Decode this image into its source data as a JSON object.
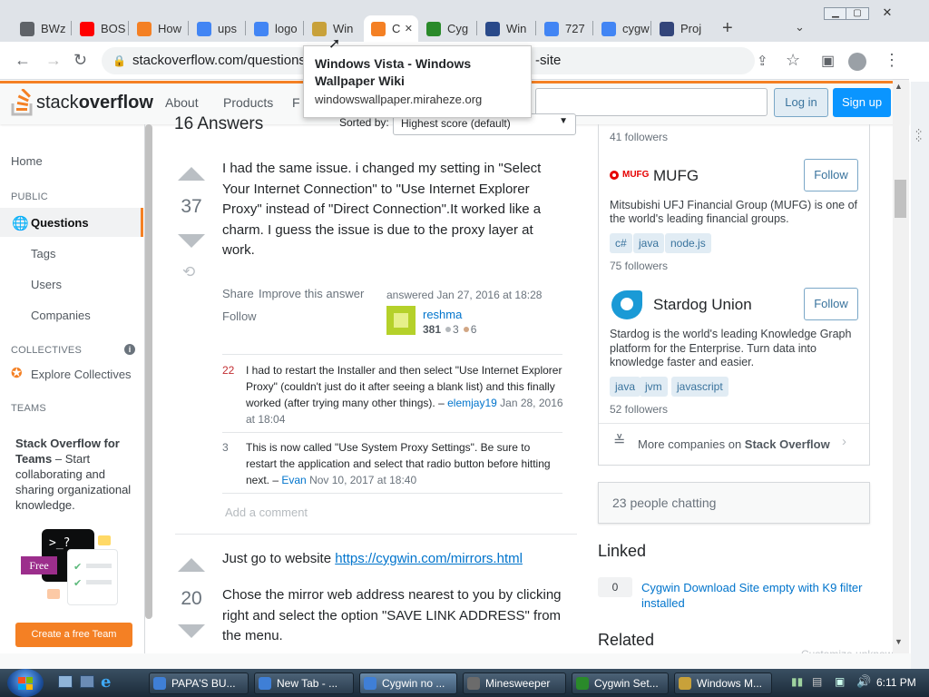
{
  "browser": {
    "tabs": [
      {
        "label": "BWz",
        "fav_color": "#5f6368",
        "icon": "clipboard-icon"
      },
      {
        "label": "BOS",
        "fav_color": "#ff0000",
        "icon": "youtube-icon"
      },
      {
        "label": "How",
        "fav_color": "#f48024",
        "icon": "stackoverflow-icon"
      },
      {
        "label": "ups",
        "fav_color": "#4285f4",
        "icon": "google-icon"
      },
      {
        "label": "logo",
        "fav_color": "#4285f4",
        "icon": "google-icon"
      },
      {
        "label": "Win",
        "fav_color": "#c8a13a",
        "icon": "wiki-icon"
      },
      {
        "label": "C",
        "fav_color": "#f48024",
        "icon": "stackoverflow-icon",
        "active": true
      },
      {
        "label": "Cyg",
        "fav_color": "#2a8a2a",
        "icon": "cygwin-icon"
      },
      {
        "label": "Win",
        "fav_color": "#2a4a8a",
        "icon": "windows-icon"
      },
      {
        "label": "727",
        "fav_color": "#4285f4",
        "icon": "google-icon"
      },
      {
        "label": "cygw",
        "fav_color": "#4285f4",
        "icon": "google-icon"
      },
      {
        "label": "Proj",
        "fav_color": "#33457a",
        "icon": "project-icon"
      }
    ],
    "url": "stackoverflow.com/questions,",
    "url_tail": "-site",
    "tooltip": {
      "title": "Windows Vista - Windows Wallpaper Wiki",
      "domain": "windowswallpaper.miraheze.org"
    }
  },
  "so": {
    "logo_text_1": "stack",
    "logo_text_2": "overflow",
    "nav": [
      "About",
      "Products",
      "F"
    ],
    "login": "Log in",
    "signup": "Sign up"
  },
  "sidebar": {
    "home": "Home",
    "public": "PUBLIC",
    "questions": "Questions",
    "tags": "Tags",
    "users": "Users",
    "companies": "Companies",
    "collectives": "COLLECTIVES",
    "explore": "Explore Collectives",
    "teams": "TEAMS",
    "teams_title": "Stack Overflow for Teams",
    "teams_text": " – Start collaborating and sharing organizational knowledge.",
    "free": "Free",
    "create_team": "Create a free Team"
  },
  "main": {
    "answers_count": "16 Answers",
    "sorted_by": "Sorted by:",
    "sort_value": "Highest score (default)",
    "answer1": {
      "score": "37",
      "text": "I had the same issue. i changed my setting in \"Select Your Internet Connection\" to \"Use Internet Explorer Proxy\" instead of \"Direct Connection\".It worked like a charm. I guess the issue is due to the proxy layer at work.",
      "share": "Share",
      "improve": "Improve this answer",
      "follow": "Follow",
      "answered": "answered Jan 27, 2016 at 18:28",
      "user": "reshma",
      "rep": "381",
      "silver": "3",
      "bronze": "6"
    },
    "comments": [
      {
        "score": "22",
        "text": "I had to restart the Installer and then select \"Use Internet Explorer Proxy\" (couldn't just do it after seeing a blank list) and this finally worked (after trying many other things).",
        "user": "elemjay19",
        "date": "Jan 28, 2016 at 18:04"
      },
      {
        "score": "3",
        "text": "This is now called \"Use System Proxy Settings\". Be sure to restart the application and select that radio button before hitting next.",
        "user": "Evan",
        "date": "Nov 10, 2017 at 18:40"
      }
    ],
    "add_comment": "Add a comment",
    "answer2": {
      "score": "20",
      "text1": "Just go to website ",
      "link": "https://cygwin.com/mirrors.html",
      "text2": "Chose the mirror web address nearest to you by clicking right and select the option \"SAVE LINK ADDRESS\" from the menu."
    }
  },
  "right": {
    "followers_top": "41 followers",
    "companies": [
      {
        "name": "MUFG",
        "follow": "Follow",
        "desc": "Mitsubishi UFJ Financial Group (MUFG) is one of the world's leading financial groups.",
        "tags": [
          "c#",
          "java",
          "node.js"
        ],
        "followers": "75 followers"
      },
      {
        "name": "Stardog Union",
        "follow": "Follow",
        "desc": "Stardog is the world's leading Knowledge Graph platform for the Enterprise. Turn data into knowledge faster and easier.",
        "tags": [
          "java",
          "jvm",
          "javascript"
        ],
        "followers": "52 followers"
      }
    ],
    "more_companies_prefix": "More companies on ",
    "more_companies_bold": "Stack Overflow",
    "chat": "23 people chatting",
    "linked_title": "Linked",
    "linked_score": "0",
    "linked_text": "Cygwin Download Site empty with K9 filter installed",
    "related_title": "Related",
    "customize": "Customize unknown"
  },
  "taskbar": {
    "items": [
      {
        "label": "PAPA'S BU...",
        "color": "#3f7fd6"
      },
      {
        "label": "New Tab - ...",
        "color": "#3f7fd6"
      },
      {
        "label": "Cygwin no ...",
        "color": "#3f7fd6"
      },
      {
        "label": "Minesweeper",
        "color": "#6b6b6b"
      },
      {
        "label": "Cygwin Set...",
        "color": "#2a8a2a"
      },
      {
        "label": "Windows M...",
        "color": "#c8a13a"
      }
    ],
    "time": "6:11 PM"
  }
}
